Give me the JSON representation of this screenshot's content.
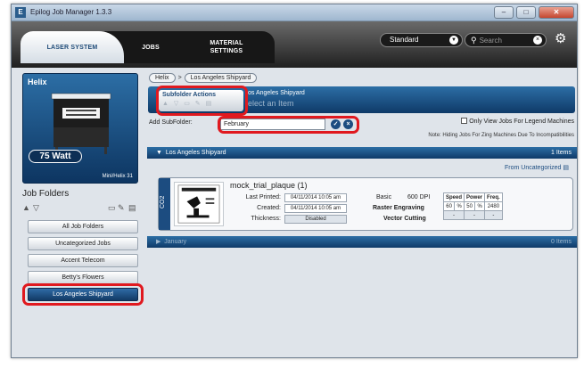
{
  "window": {
    "title": "Epilog Job Manager 1.3.3",
    "app_icon": "E"
  },
  "top_tabs": {
    "laser": "LASER SYSTEM",
    "jobs": "JOBS",
    "material": "MATERIAL SETTINGS"
  },
  "toolbar": {
    "profile": "Standard",
    "search_placeholder": "Search"
  },
  "machine": {
    "name": "Helix",
    "wattage": "75 Watt",
    "model": "Mini/Helix 31"
  },
  "job_folders": {
    "title": "Job Folders",
    "folders": [
      {
        "label": "All Job Folders"
      },
      {
        "label": "Uncategorized Jobs"
      },
      {
        "label": "Accent Telecom"
      },
      {
        "label": "Betty's Flowers"
      },
      {
        "label": "Los Angeles Shipyard"
      }
    ]
  },
  "breadcrumb": {
    "root": "Helix",
    "current": "Los Angeles Shipyard"
  },
  "subfolder": {
    "actions_label": "Subfolder Actions",
    "folder_name": "os Angeles Shipyard",
    "hint": "elect an Item",
    "add_label": "Add SubFolder:",
    "add_value": "February",
    "only_view_label": "Only View Jobs For Legend Machines",
    "note": "Note: Hiding Jobs For Zing Machines Due To Incompatibilities"
  },
  "groups": [
    {
      "name": "Los Angeles Shipyard",
      "count": "1 Items"
    },
    {
      "name": "January",
      "count": "0 Items"
    }
  ],
  "from_label": "From Uncategorized",
  "job": {
    "name": "mock_trial_plaque (1)",
    "type": "CO2",
    "last_printed_label": "Last Printed:",
    "last_printed": "04/11/2014 10:05 am",
    "created_label": "Created:",
    "created": "04/11/2014 10:05 am",
    "thickness_label": "Thickness:",
    "thickness": "Disabled",
    "basic_label": "Basic",
    "dpi": "600 DPI",
    "raster_label": "Raster Engraving",
    "vector_label": "Vector Cutting",
    "headers": {
      "speed": "Speed",
      "power": "Power",
      "freq": "Freq."
    },
    "raster": {
      "speed": "60",
      "speed_unit": "%",
      "power": "50",
      "power_unit": "%",
      "freq": "2480"
    },
    "vector": {
      "speed": "-",
      "power": "-",
      "freq": "-"
    }
  },
  "colors": {
    "accent_blue": "#1c4c80",
    "highlight_red": "#e0191f"
  }
}
